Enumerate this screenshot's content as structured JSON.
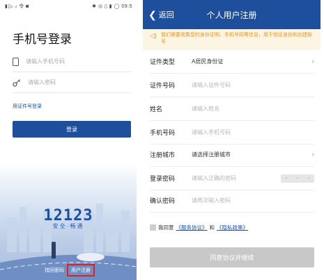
{
  "login_screen": {
    "status_bar": {
      "left": "▮▯ᵢₗ ᵢₗ 令 ◙",
      "right": "✱ ◎ ▯ ▮ ◯ 09:5"
    },
    "title": "手机号登录",
    "phone_placeholder": "请输入手机号码",
    "password_placeholder": "请输入密码",
    "id_login_link": "用证件号登录",
    "login_button": "登录",
    "logo_text": "12123",
    "logo_slogan": "安全·畅通",
    "footer": {
      "retrieve_password": "找回密码",
      "register": "用户注册"
    },
    "highlight_color": "#e02020"
  },
  "register_screen": {
    "nav": {
      "back_label": "返回",
      "title": "个人用户注册"
    },
    "notice": "我们需要收集您的身份证明、手机号码等信息，用于验证身份和创建账号",
    "fields": [
      {
        "label": "证件类型",
        "value": "A居民身份证",
        "placeholder": ""
      },
      {
        "label": "证件号码",
        "value": "",
        "placeholder": "请输入证件号码"
      },
      {
        "label": "姓名",
        "value": "",
        "placeholder": "请输入姓名"
      },
      {
        "label": "手机号码",
        "value": "",
        "placeholder": "请输入手机号码"
      },
      {
        "label": "注册城市",
        "value": "请选择注册城市",
        "placeholder": ""
      },
      {
        "label": "登录密码",
        "value": "",
        "placeholder": "请输入正确的密码"
      },
      {
        "label": "确认密码",
        "value": "",
        "placeholder": "请再次输入密码"
      }
    ],
    "agreement": {
      "prefix": "我同意",
      "service": "《服务协议》",
      "and": "和",
      "privacy": "《隐私政策》"
    },
    "submit_button": "同意协议并继续"
  },
  "colors": {
    "brand_blue": "#1e4f9c",
    "notice_orange": "#e0952a",
    "disabled_gray": "#c8c8c8"
  }
}
